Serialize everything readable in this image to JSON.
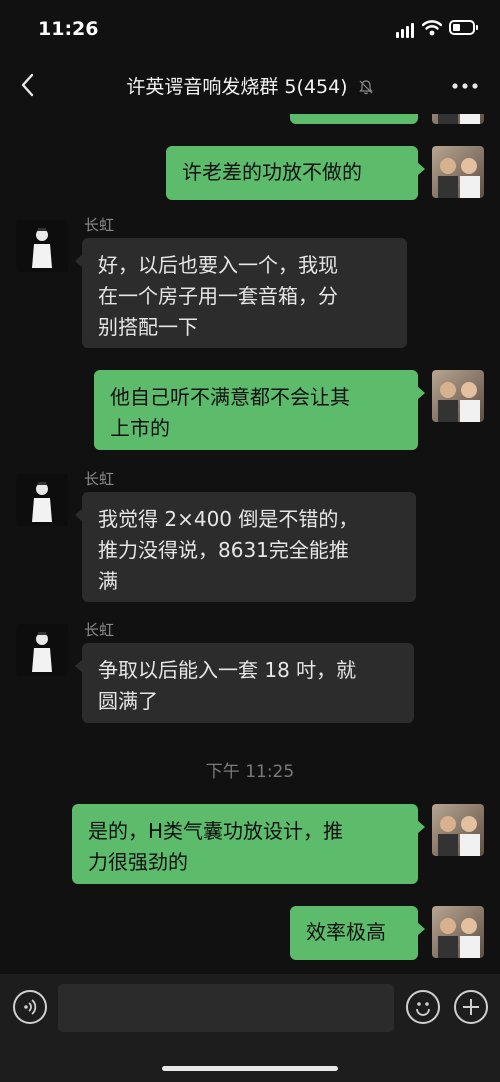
{
  "status_bar": {
    "time": "11:26"
  },
  "header": {
    "title": "许英谔音响发烧群 5(454)"
  },
  "messages": [
    {
      "from": "me",
      "text": "许老差的功放不做的"
    },
    {
      "from": "other",
      "sender": "长虹",
      "text": "好，以后也要入一个，我现\n在一个房子用一套音箱，分\n别搭配一下"
    },
    {
      "from": "me",
      "text": "他自己听不满意都不会让其\n上市的"
    },
    {
      "from": "other",
      "sender": "长虹",
      "text": "我觉得 2×400 倒是不错的，\n推力没得说，8631完全能推\n满"
    },
    {
      "from": "other",
      "sender": "长虹",
      "text": "争取以后能入一套 18 吋，就\n圆满了"
    },
    {
      "timestamp": "下午 11:25"
    },
    {
      "from": "me",
      "text": "是的，H类气囊功放设计，推\n力很强劲的"
    },
    {
      "from": "me",
      "text": "效率极高"
    }
  ],
  "input_bar": {
    "placeholder": ""
  },
  "colors": {
    "bubble_me": "#5dbc6c",
    "bubble_other": "#2c2c2c",
    "background": "#111111"
  }
}
